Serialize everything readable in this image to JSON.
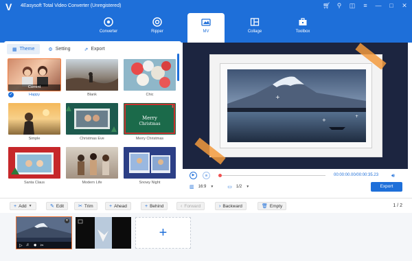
{
  "app": {
    "title": "4Easysoft Total Video Converter (Unregistered)",
    "logo_text": "V"
  },
  "window_controls": [
    "cart-icon",
    "key-icon",
    "chat-icon",
    "menu-icon",
    "minimize-icon",
    "maximize-icon",
    "close-icon"
  ],
  "nav": {
    "items": [
      {
        "label": "Converter",
        "icon": "converter-icon"
      },
      {
        "label": "Ripper",
        "icon": "ripper-icon"
      },
      {
        "label": "MV",
        "icon": "mv-icon",
        "active": true
      },
      {
        "label": "Collage",
        "icon": "collage-icon"
      },
      {
        "label": "Toolbox",
        "icon": "toolbox-icon"
      }
    ]
  },
  "tabs": [
    {
      "label": "Theme",
      "active": true
    },
    {
      "label": "Setting"
    },
    {
      "label": "Export"
    }
  ],
  "themes": [
    {
      "label": "Happy",
      "active": true,
      "current_label": "Current"
    },
    {
      "label": "Blank"
    },
    {
      "label": "Chic"
    },
    {
      "label": "Simple"
    },
    {
      "label": "Christmas Eve"
    },
    {
      "label": "Merry Christmas",
      "downloadable": true
    },
    {
      "label": "Santa Claus"
    },
    {
      "label": "Modern Life"
    },
    {
      "label": "Snowy Night"
    }
  ],
  "player": {
    "current_time": "00:00:00.00",
    "total_time": "00:00:35.23",
    "time_sep": "/",
    "aspect_ratio": "16:9",
    "screen": "1/2",
    "export_label": "Export"
  },
  "toolbar": {
    "add": "Add",
    "edit": "Edit",
    "trim": "Trim",
    "ahead": "Ahead",
    "behind": "Behind",
    "forward": "Forward",
    "backward": "Backward",
    "empty": "Empty",
    "page_current": "1",
    "page_sep": "/",
    "page_total": "2"
  },
  "colors": {
    "accent": "#1e6fd9",
    "selection": "#f47a3a"
  }
}
